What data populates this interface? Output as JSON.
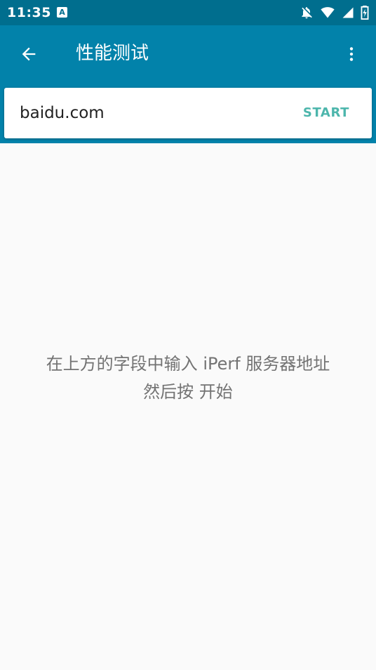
{
  "status_bar": {
    "time": "11:35",
    "notification_icon": "a-notification-icon",
    "icons": [
      "notifications-off-icon",
      "wifi-icon",
      "signal-icon",
      "battery-icon"
    ],
    "background": "#006e8e"
  },
  "app_bar": {
    "title": "性能测试",
    "back_icon": "arrow-back-icon",
    "menu_icon": "more-vert-icon",
    "background": "#0282aa"
  },
  "host_input": {
    "value": "baidu.com",
    "placeholder": ""
  },
  "start_button": {
    "label": "START",
    "color": "#4db6ac"
  },
  "hint": {
    "line1": "在上方的字段中输入 iPerf 服务器地址",
    "line2": "然后按 开始"
  }
}
